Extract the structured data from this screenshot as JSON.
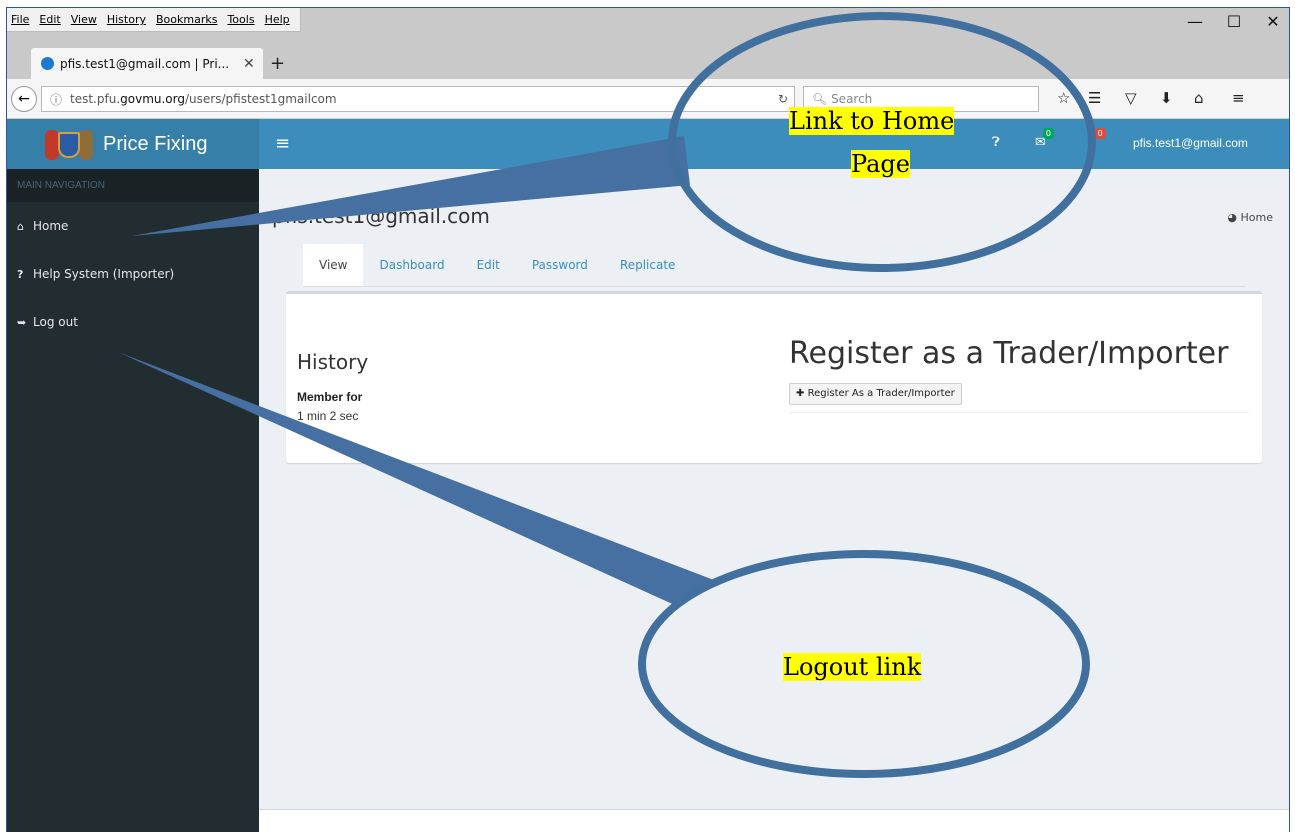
{
  "menu": [
    "File",
    "Edit",
    "View",
    "History",
    "Bookmarks",
    "Tools",
    "Help"
  ],
  "window_controls": {
    "minimize": "—",
    "maximize": "☐",
    "close": "✕"
  },
  "tab": {
    "title": "pfis.test1@gmail.com | Pri...",
    "close": "✕",
    "new_tab": "+"
  },
  "address": {
    "prefix": "test.pfu.",
    "host": "govmu.org",
    "path": "/users/pfistest1gmailcom",
    "search_placeholder": "Search"
  },
  "site": {
    "brand": "Price Fixing",
    "user_email": "pfis.test1@gmail.com",
    "badges": {
      "messages": "0",
      "flags": "0"
    }
  },
  "sidebar": {
    "header": "MAIN NAVIGATION",
    "items": [
      {
        "icon": "home-icon",
        "label": "Home"
      },
      {
        "icon": "question-icon",
        "label": "Help System (Importer)"
      },
      {
        "icon": "logout-icon",
        "label": "Log out"
      }
    ]
  },
  "main": {
    "title": "pfis.test1@gmail.com",
    "breadcrumb": "Home",
    "tabs": [
      "View",
      "Dashboard",
      "Edit",
      "Password",
      "Replicate"
    ],
    "active_tab": "View",
    "history_title": "History",
    "member_label": "Member for",
    "member_value": "1 min 2 sec",
    "register_title": "Register as a Trader/Importer",
    "register_button": "Register As a Trader/Importer"
  },
  "callouts": {
    "home": "Link to Home Page",
    "home_line1": "Link to Home",
    "home_line2": "Page",
    "logout": "Logout link"
  },
  "colors": {
    "header": "#3c8dbc",
    "logo_bg": "#367fa9",
    "sidebar": "#222d32",
    "highlight": "#ffff00",
    "callout_stroke": "#41709f"
  }
}
